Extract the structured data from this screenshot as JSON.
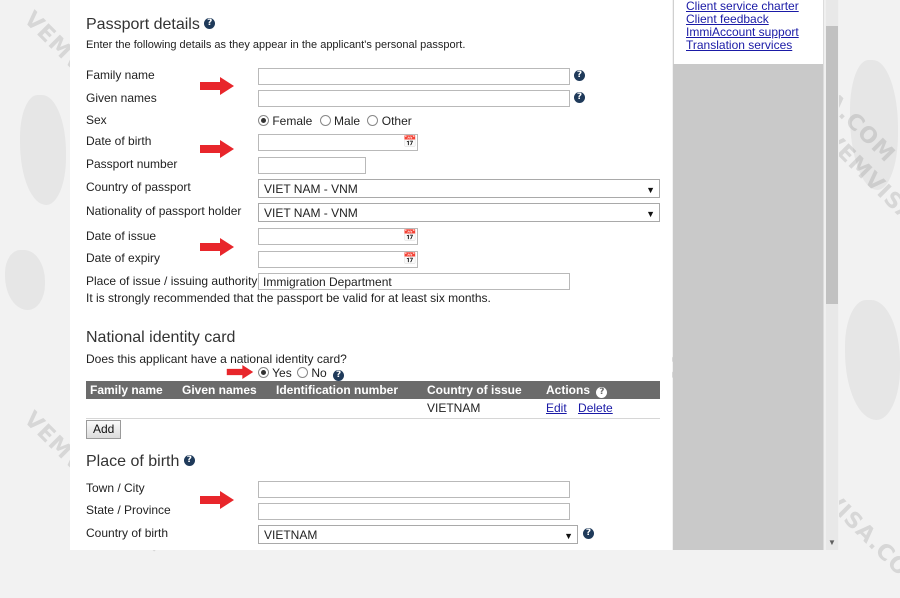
{
  "sidebar": {
    "links": [
      "Client service charter",
      "Client feedback",
      "ImmiAccount support",
      "Translation services"
    ]
  },
  "passport": {
    "title": "Passport details",
    "help_icon": "question-icon",
    "intro": "Enter the following details as they appear in the applicant's personal passport.",
    "family_name_label": "Family name",
    "given_names_label": "Given names",
    "sex_label": "Sex",
    "sex_options": [
      "Female",
      "Male",
      "Other"
    ],
    "sex_selected": "Female",
    "dob_label": "Date of birth",
    "passport_number_label": "Passport number",
    "country_label": "Country of passport",
    "country_value": "VIET NAM - VNM",
    "nationality_label": "Nationality of passport holder",
    "nationality_value": "VIET NAM - VNM",
    "issue_date_label": "Date of issue",
    "expiry_date_label": "Date of expiry",
    "authority_label": "Place of issue / issuing authority",
    "authority_value": "Immigration Department",
    "validity_note": "It is strongly recommended that the passport be valid for at least six months."
  },
  "national_id": {
    "title": "National identity card",
    "question": "Does this applicant have a national identity card?",
    "yes_label": "Yes",
    "no_label": "No",
    "selected": "Yes",
    "columns": [
      "Family name",
      "Given names",
      "Identification number",
      "Country of issue",
      "Actions"
    ],
    "rows": [
      {
        "family_name": "",
        "given_names": "",
        "id_number": "",
        "country": "VIETNAM",
        "edit": "Edit",
        "delete": "Delete"
      }
    ],
    "add_label": "Add"
  },
  "birth": {
    "title": "Place of birth",
    "town_label": "Town / City",
    "state_label": "State / Province",
    "country_label": "Country of birth",
    "country_value": "VIETNAM"
  },
  "watermark": "VEMVISA.COM",
  "colors": {
    "accent_red": "#e8262b",
    "link": "#1a1aa6",
    "table_header": "#6b6b6b"
  }
}
